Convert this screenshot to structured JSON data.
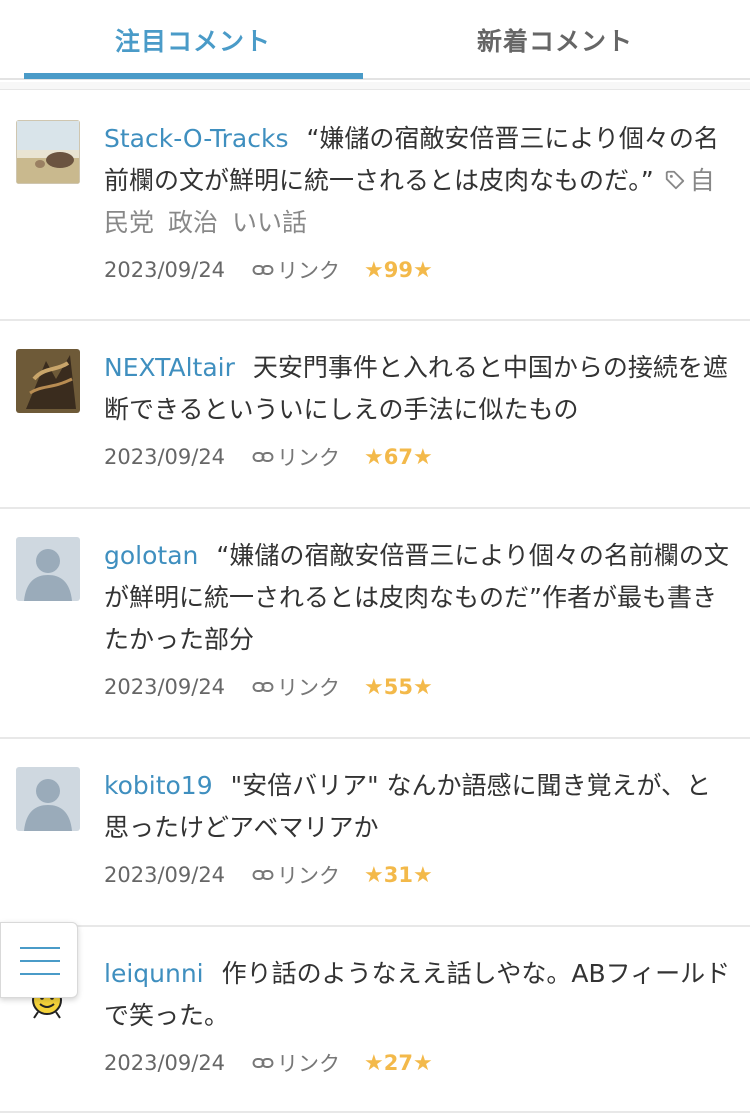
{
  "tabs": [
    {
      "label": "注目コメント"
    },
    {
      "label": "新着コメント"
    }
  ],
  "accent_color": "#4a9bc8",
  "star_color": "#f3b94a",
  "comments": [
    {
      "user": "Stack-O-Tracks",
      "text": "“嫌儲の宿敵安倍晋三により個々の名前欄の文が鮮明に統一されるとは皮肉なものだ。”",
      "tags": [
        "自民党",
        "政治",
        "いい話"
      ],
      "date": "2023/09/24",
      "link": "リンク",
      "stars": "99"
    },
    {
      "user": "NEXTAltair",
      "text": "天安門事件と入れると中国からの接続を遮断できるといういにしえの手法に似たもの",
      "date": "2023/09/24",
      "link": "リンク",
      "stars": "67"
    },
    {
      "user": "golotan",
      "text": "“嫌儲の宿敵安倍晋三により個々の名前欄の文が鮮明に統一されるとは皮肉なものだ”作者が最も書きたかった部分",
      "date": "2023/09/24",
      "link": "リンク",
      "stars": "55"
    },
    {
      "user": "kobito19",
      "text": "\"安倍バリア\" なんか語感に聞き覚えが、と思ったけどアベマリアか",
      "date": "2023/09/24",
      "link": "リンク",
      "stars": "31"
    },
    {
      "user": "leiqunni",
      "text": "作り話のようなええ話しやな。ABフィールドで笑った。",
      "date": "2023/09/24",
      "link": "リンク",
      "stars": "27"
    }
  ]
}
